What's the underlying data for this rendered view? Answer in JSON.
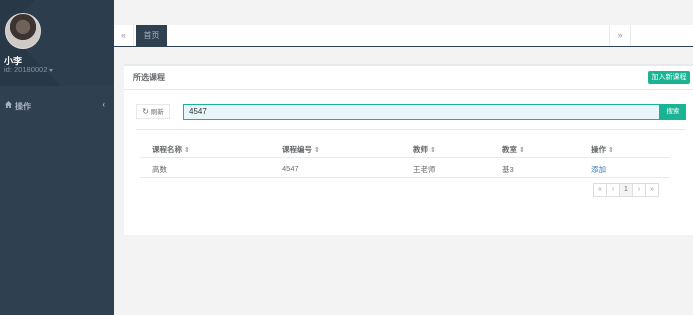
{
  "user": {
    "name": "小李",
    "id_text": "id: 20180002"
  },
  "sidebar": {
    "items": [
      {
        "label": "操作"
      }
    ]
  },
  "tabs": {
    "prev": "«",
    "next": "»",
    "items": [
      {
        "label": "首页"
      }
    ]
  },
  "panel": {
    "title": "所选课程",
    "add_button": "加入新课程"
  },
  "toolbar": {
    "refresh_label": "刷新",
    "search_value": "4547",
    "search_button": "搜索"
  },
  "table": {
    "columns": [
      "课程名称",
      "课程编号",
      "教师",
      "教室",
      "操作"
    ],
    "rows": [
      {
        "name": "高数",
        "code": "4547",
        "teacher": "王老师",
        "room": "基3",
        "action": "添加"
      }
    ]
  },
  "pagination": {
    "first": "«",
    "prev": "‹",
    "current": "1",
    "next": "›",
    "last": "»"
  },
  "colors": {
    "sidebar": "#2f4050",
    "accent": "#1ab394",
    "link": "#337ab7"
  }
}
